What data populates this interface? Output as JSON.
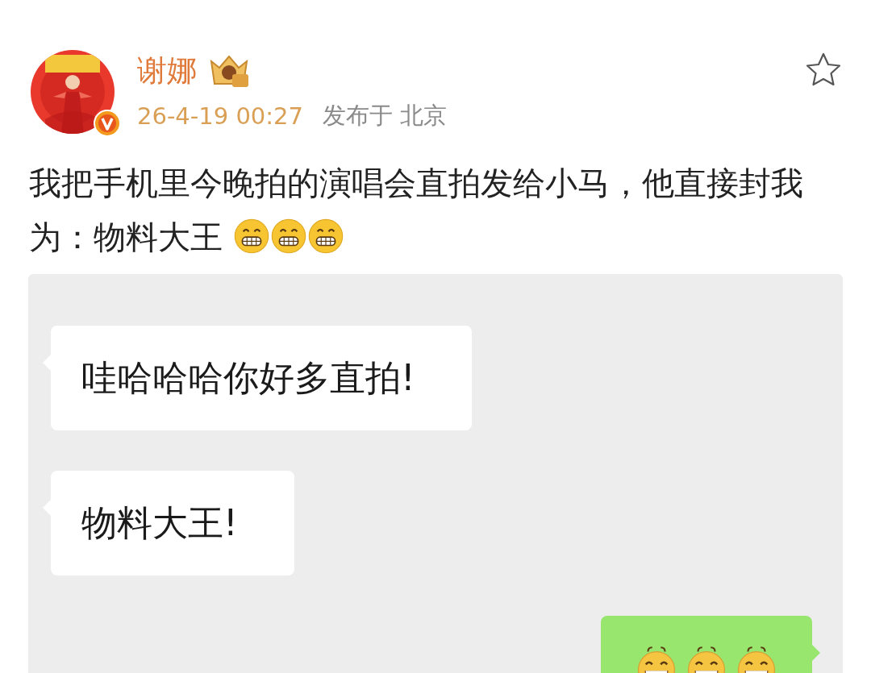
{
  "post": {
    "author": "谢娜",
    "verified": true,
    "time": "26-4-19 00:27",
    "location": "发布于 北京",
    "favorited": false,
    "text": "我把手机里今晚拍的演唱会直拍发给小马，他直接封我为：物料大王",
    "emojis": [
      {
        "kind": "grin"
      },
      {
        "kind": "grin"
      },
      {
        "kind": "grin"
      }
    ]
  },
  "chat": {
    "messages": [
      {
        "outgoing": false,
        "text": "哇哈哈哈你好多直拍!"
      },
      {
        "outgoing": false,
        "text": "物料大王!"
      },
      {
        "outgoing": true,
        "emojis": [
          {
            "kind": "laugh"
          },
          {
            "kind": "laugh"
          },
          {
            "kind": "laugh"
          }
        ]
      }
    ]
  }
}
